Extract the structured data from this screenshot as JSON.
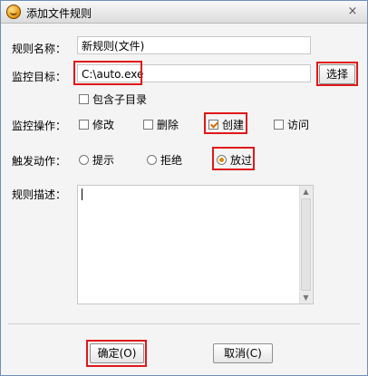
{
  "window": {
    "title": "添加文件规则",
    "close_glyph": "×",
    "app_icon": "shield-logo-icon",
    "close_icon": "close-icon"
  },
  "form": {
    "rule_name": {
      "label": "规则名称：",
      "value": "新规则(文件)"
    },
    "target": {
      "label": "监控目标：",
      "value": "C:\\auto.exe",
      "browse_button": "选择"
    },
    "include_subdirs": {
      "label": "包含子目录",
      "checked": false
    },
    "operations": {
      "label": "监控操作：",
      "options": [
        {
          "label": "修改",
          "checked": false
        },
        {
          "label": "删除",
          "checked": false
        },
        {
          "label": "创建",
          "checked": true
        },
        {
          "label": "访问",
          "checked": false
        }
      ]
    },
    "action": {
      "label": "触发动作：",
      "options": [
        {
          "label": "提示",
          "selected": false
        },
        {
          "label": "拒绝",
          "selected": false
        },
        {
          "label": "放过",
          "selected": true
        }
      ]
    },
    "description": {
      "label": "规则描述：",
      "value": ""
    }
  },
  "footer": {
    "ok_button": "确定(O)",
    "cancel_button": "取消(C)"
  },
  "colors": {
    "highlight": "#e01818",
    "check_mark": "#d46b00",
    "radio_dot": "#e08a00"
  }
}
